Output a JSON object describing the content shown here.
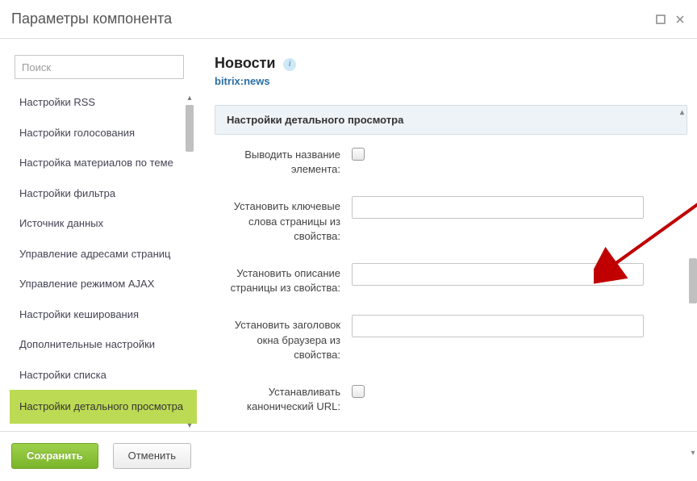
{
  "dialog": {
    "title": "Параметры компонента"
  },
  "search": {
    "placeholder": "Поиск"
  },
  "sidebar": {
    "items": [
      {
        "label": "Настройки RSS",
        "active": false
      },
      {
        "label": "Настройки голосования",
        "active": false
      },
      {
        "label": "Настройка материалов по теме",
        "active": false
      },
      {
        "label": "Настройки фильтра",
        "active": false
      },
      {
        "label": "Источник данных",
        "active": false
      },
      {
        "label": "Управление адресами страниц",
        "active": false
      },
      {
        "label": "Управление режимом AJAX",
        "active": false
      },
      {
        "label": "Настройки кеширования",
        "active": false
      },
      {
        "label": "Дополнительные настройки",
        "active": false
      },
      {
        "label": "Настройки списка",
        "active": false
      },
      {
        "label": "Настройки детального просмотра",
        "active": true
      }
    ]
  },
  "component": {
    "title": "Новости",
    "code": "bitrix:news"
  },
  "section": {
    "title": "Настройки детального просмотра"
  },
  "fields": {
    "show_element_name": "Выводить название элемента:",
    "set_keywords": "Установить ключевые слова страницы из свойства:",
    "set_description": "Установить описание страницы из свойства:",
    "set_browser_title": "Установить заголовок окна браузера из свойства:",
    "set_canonical": "Устанавливать канонический URL:"
  },
  "footer": {
    "save": "Сохранить",
    "cancel": "Отменить"
  }
}
